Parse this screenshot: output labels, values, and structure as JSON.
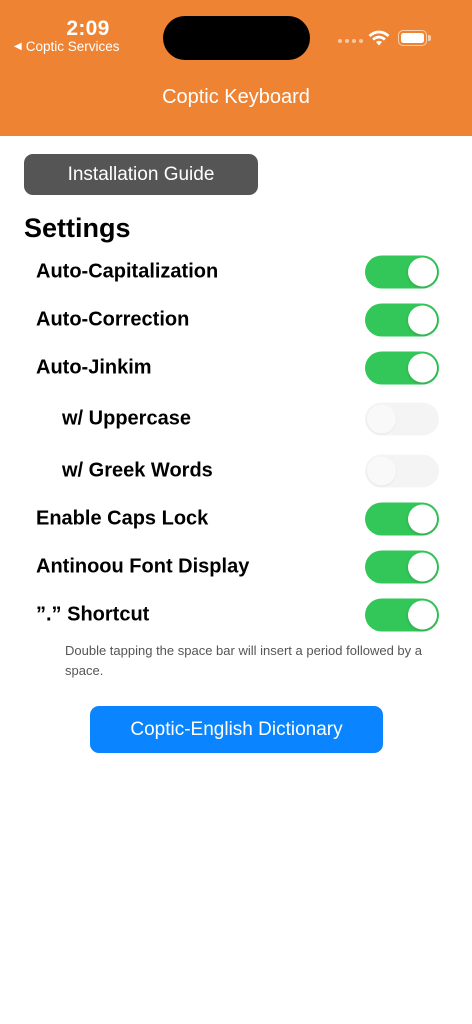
{
  "status_bar": {
    "time": "2:09",
    "back_app": "Coptic Services",
    "back_icon": "back-triangle-icon"
  },
  "nav": {
    "title": "Coptic Keyboard",
    "background": "#ee8433"
  },
  "installation_button": {
    "label": "Installation Guide"
  },
  "settings": {
    "title": "Settings",
    "rows": [
      {
        "label": "Auto-Capitalization",
        "on": true
      },
      {
        "label": "Auto-Correction",
        "on": true
      },
      {
        "label": "Auto-Jinkim",
        "on": true
      },
      {
        "label": "w/ Uppercase",
        "on": false
      },
      {
        "label": "w/ Greek Words",
        "on": false
      },
      {
        "label": "Enable Caps Lock",
        "on": true
      },
      {
        "label": "Antinoou Font Display",
        "on": true
      },
      {
        "label": "”.” Shortcut",
        "on": true
      }
    ],
    "footnote": "Double tapping the space bar will insert a period followed by a space."
  },
  "dictionary_button": {
    "label": "Coptic-English Dictionary"
  },
  "colors": {
    "accent": "#0a84ff",
    "toggle_on": "#33c759",
    "guide_button": "#555555"
  }
}
